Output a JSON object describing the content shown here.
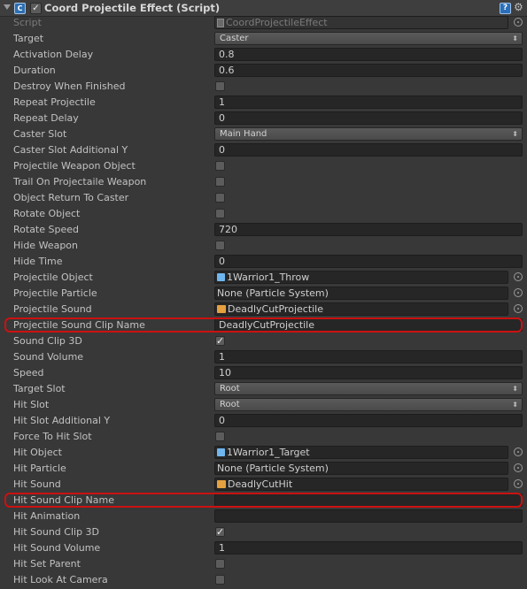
{
  "header": {
    "title": "Coord Projectile Effect (Script)",
    "icons": [
      "foldout-arrow-icon",
      "csharp-script-icon",
      "enabled-checkbox",
      "help-icon",
      "gear-icon"
    ]
  },
  "script": {
    "label": "Script",
    "value": "CoordProjectileEffect"
  },
  "fields": {
    "target": {
      "label": "Target",
      "value": "Caster"
    },
    "activation_delay": {
      "label": "Activation Delay",
      "value": "0.8"
    },
    "duration": {
      "label": "Duration",
      "value": "0.6"
    },
    "destroy_when_finished": {
      "label": "Destroy When Finished",
      "checked": false
    },
    "repeat_projectile": {
      "label": "Repeat Projectile",
      "value": "1"
    },
    "repeat_delay": {
      "label": "Repeat Delay",
      "value": "0"
    },
    "caster_slot": {
      "label": "Caster Slot",
      "value": "Main Hand"
    },
    "caster_slot_additional_y": {
      "label": "Caster Slot Additional Y",
      "value": "0"
    },
    "projectile_weapon_object": {
      "label": "Projectile Weapon Object",
      "checked": false
    },
    "trail_on_projectaile_weapon": {
      "label": "Trail On Projectaile Weapon",
      "checked": false
    },
    "object_return_to_caster": {
      "label": "Object Return To Caster",
      "checked": false
    },
    "rotate_object": {
      "label": "Rotate Object",
      "checked": false
    },
    "rotate_speed": {
      "label": "Rotate Speed",
      "value": "720"
    },
    "hide_weapon": {
      "label": "Hide Weapon",
      "checked": false
    },
    "hide_time": {
      "label": "Hide Time",
      "value": "0"
    },
    "projectile_object": {
      "label": "Projectile Object",
      "value": "1Warrior1_Throw"
    },
    "projectile_particle": {
      "label": "Projectile Particle",
      "value": "None (Particle System)"
    },
    "projectile_sound": {
      "label": "Projectile Sound",
      "value": "DeadlyCutProjectile"
    },
    "projectile_sound_clip_name": {
      "label": "Projectile Sound Clip Name",
      "value": "DeadlyCutProjectile"
    },
    "sound_clip_3d": {
      "label": "Sound Clip 3D",
      "checked": true
    },
    "sound_volume": {
      "label": "Sound Volume",
      "value": "1"
    },
    "speed": {
      "label": "Speed",
      "value": "10"
    },
    "target_slot": {
      "label": "Target Slot",
      "value": "Root"
    },
    "hit_slot": {
      "label": "Hit Slot",
      "value": "Root"
    },
    "hit_slot_additional_y": {
      "label": "Hit Slot Additional Y",
      "value": "0"
    },
    "force_to_hit_slot": {
      "label": "Force To Hit Slot",
      "checked": false
    },
    "hit_object": {
      "label": "Hit Object",
      "value": "1Warrior1_Target"
    },
    "hit_particle": {
      "label": "Hit Particle",
      "value": "None (Particle System)"
    },
    "hit_sound": {
      "label": "Hit Sound",
      "value": "DeadlyCutHit"
    },
    "hit_sound_clip_name": {
      "label": "Hit Sound Clip Name",
      "value": ""
    },
    "hit_animation": {
      "label": "Hit Animation",
      "value": ""
    },
    "hit_sound_clip_3d": {
      "label": "Hit Sound Clip 3D",
      "checked": true
    },
    "hit_sound_volume": {
      "label": "Hit Sound Volume",
      "value": "1"
    },
    "hit_set_parent": {
      "label": "Hit Set Parent",
      "checked": false
    },
    "hit_look_at_camera": {
      "label": "Hit Look At Camera",
      "checked": false
    }
  },
  "colors": {
    "highlight": "#cc1111",
    "background": "#383838",
    "field": "#262626"
  }
}
